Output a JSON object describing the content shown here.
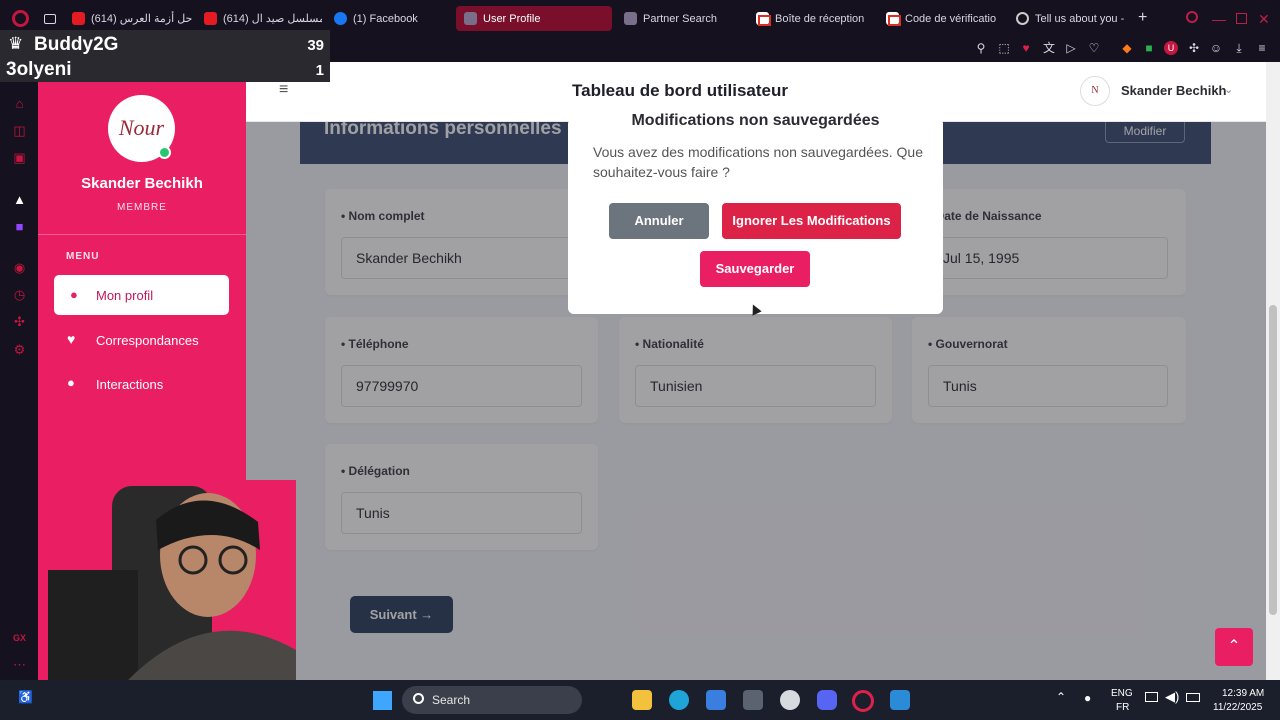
{
  "browser": {
    "tabs": [
      {
        "label": "(614) حل أزمة العرس",
        "icon": "youtube-icon",
        "active": false
      },
      {
        "label": "(614) مسلسل صيد ال",
        "icon": "youtube-icon",
        "active": false
      },
      {
        "label": "(1) Facebook",
        "icon": "facebook-icon",
        "active": false
      },
      {
        "label": "User Profile",
        "icon": "page-icon",
        "active": true
      },
      {
        "label": "Partner Search",
        "icon": "page-icon",
        "active": false
      },
      {
        "label": "Boîte de réception",
        "icon": "gmail-icon",
        "active": false
      },
      {
        "label": "Code de vérificatio",
        "icon": "gmail-icon",
        "active": false
      },
      {
        "label": "Tell us about you -",
        "icon": "chatgpt-icon",
        "active": false
      }
    ],
    "accent": "#c4163e"
  },
  "overlay": {
    "name1": "Buddy2G",
    "name2": "3olyeni",
    "count1": "39",
    "count2": "1"
  },
  "app": {
    "title": "Tableau de bord utilisateur",
    "user_name": "Skander Bechikh",
    "sidebar": {
      "logo_text": "Nour",
      "name": "Skander Bechikh",
      "role": "MEMBRE",
      "menu_heading": "MENU",
      "items": [
        {
          "label": "Mon profil",
          "icon": "user-icon",
          "active": true
        },
        {
          "label": "Correspondances",
          "icon": "heart-icon",
          "active": false
        },
        {
          "label": "Interactions",
          "icon": "comments-icon",
          "active": false
        }
      ],
      "color": "#e91e63"
    },
    "section_title": "Informations personnelles",
    "edit_button": "Modifier",
    "fields": [
      {
        "label": "Nom complet",
        "value": "Skander Bechikh"
      },
      {
        "label": "Date de Naissance",
        "value": "Jul 15, 1995"
      },
      {
        "label": "Téléphone",
        "value": "97799970"
      },
      {
        "label": "Nationalité",
        "value": "Tunisien"
      },
      {
        "label": "Gouvernorat",
        "value": "Tunis"
      },
      {
        "label": "Délégation",
        "value": "Tunis"
      }
    ],
    "next_button": "Suivant →"
  },
  "modal": {
    "title": "Modifications non sauvegardées",
    "message": "Vous avez des modifications non sauvegardées. Que souhaitez-vous faire ?",
    "cancel": "Annuler",
    "ignore": "Ignorer Les Modifications",
    "save": "Sauvegarder"
  },
  "taskbar": {
    "search_label": "Search",
    "lang1": "ENG",
    "lang2": "FR",
    "time": "12:39 AM",
    "date": "11/22/2025"
  }
}
